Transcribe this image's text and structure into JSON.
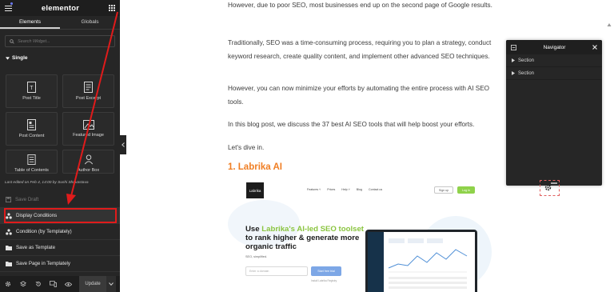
{
  "panel": {
    "brand": "elementor",
    "tabs": [
      "Elements",
      "Globals"
    ],
    "search_placeholder": "Search Widget...",
    "category": "Single",
    "widgets": [
      {
        "label": "Post Title",
        "icon": "post-title-icon"
      },
      {
        "label": "Post Excerpt",
        "icon": "post-excerpt-icon"
      },
      {
        "label": "Post Content",
        "icon": "post-content-icon"
      },
      {
        "label": "Featured Image",
        "icon": "featured-image-icon"
      },
      {
        "label": "Table of Contents",
        "icon": "table-of-contents-icon"
      },
      {
        "label": "Author Box",
        "icon": "author-box-icon"
      }
    ],
    "last_edited": "Last edited on Feb 4, 14:00 by Sushi Shrivastava",
    "menu": [
      {
        "label": "Save Draft",
        "icon": "save-draft-icon",
        "disabled": true
      },
      {
        "label": "Display Conditions",
        "icon": "display-conditions-icon"
      },
      {
        "label": "Condition (by Templately)",
        "icon": "condition-icon"
      },
      {
        "label": "Save as Template",
        "icon": "folder-icon"
      },
      {
        "label": "Save Page in Templately",
        "icon": "folder-icon"
      }
    ],
    "bottom": {
      "update_label": "Update"
    }
  },
  "content": {
    "paragraphs": [
      "However, due to poor SEO, most businesses end up on the second page of Google results.",
      "Traditionally, SEO was a time-consuming process, requiring you to plan a strategy, conduct keyword research, create quality content, and implement other advanced SEO techniques.",
      "However, you can now minimize your efforts by automating the entire process with AI SEO tools.",
      "In this blog post, we discuss the 37 best AI SEO tools that will help boost your efforts.",
      "Let's dive in."
    ],
    "heading": "1. Labrika AI",
    "screenshot": {
      "logo": "Labrika",
      "nav": [
        "Features ˅",
        "Prices",
        "Help ˅",
        "Blog",
        "Contact us"
      ],
      "sign_in": "Sign up",
      "log_in": "Log in",
      "headline_prefix": "Use ",
      "headline_highlight": "Labrika's AI-led SEO toolset",
      "headline_suffix": " to rank higher & generate more organic traffic",
      "sub": "SEO, simplified.",
      "input_placeholder": "Enter a domain",
      "button": "Start free trial",
      "note": "Install Labrika Registry"
    }
  },
  "navigator": {
    "title": "Navigator",
    "sections": [
      "Section",
      "Section"
    ]
  },
  "colors": {
    "panel_bg": "#262626",
    "accent_orange": "#f07e23",
    "annotation_red": "#e01b1b",
    "labrika_green": "#8ac43f"
  }
}
